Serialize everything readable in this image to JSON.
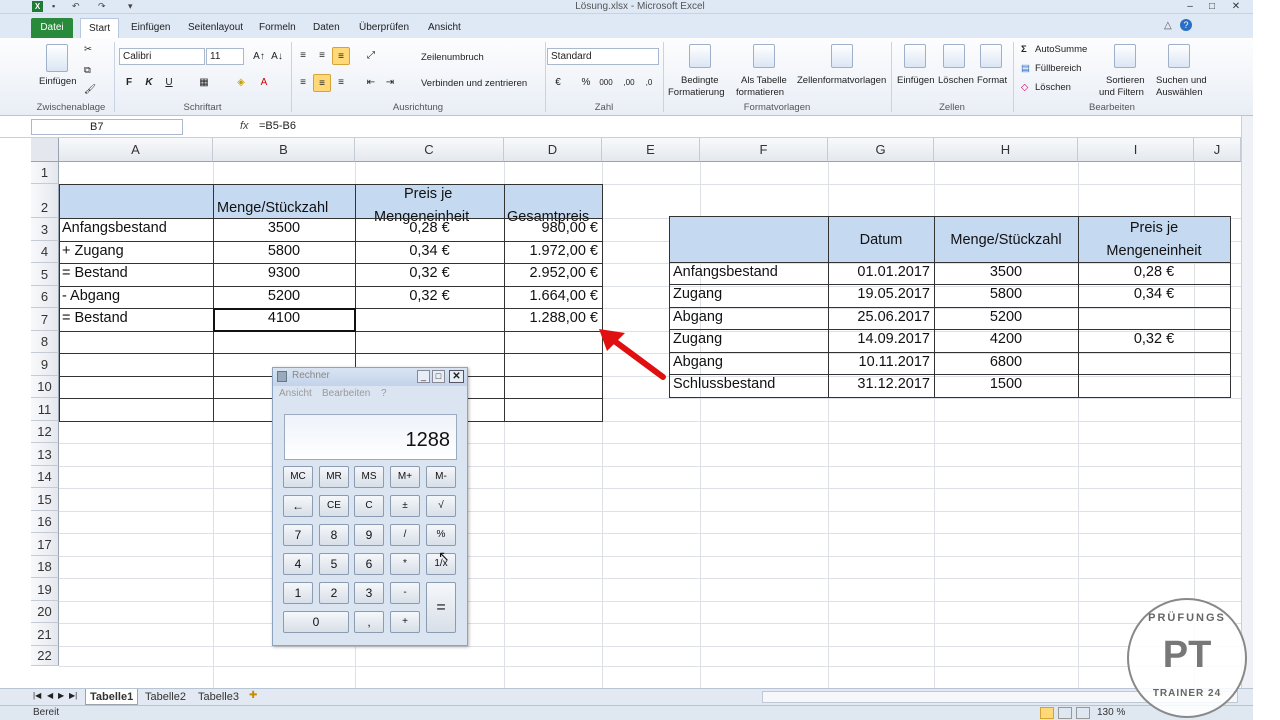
{
  "window": {
    "title": "Lösung.xlsx - Microsoft Excel",
    "controls": [
      "–",
      "□",
      "✕"
    ]
  },
  "tabs": [
    "Datei",
    "Start",
    "Einfügen",
    "Seitenlayout",
    "Formeln",
    "Daten",
    "Überprüfen",
    "Ansicht"
  ],
  "ribbon": {
    "clipboard": {
      "paste": "Einfügen",
      "group": "Zwischenablage"
    },
    "font": {
      "name": "Calibri",
      "size": "11",
      "bold": "F",
      "italic": "K",
      "underline": "U",
      "group": "Schriftart"
    },
    "alignment": {
      "wrap": "Zeilenumbruch",
      "merge": "Verbinden und zentrieren",
      "group": "Ausrichtung"
    },
    "number": {
      "format": "Standard",
      "group": "Zahl"
    },
    "styles": {
      "conditional": "Bedingte",
      "conditional2": "Formatierung",
      "astable": "Als Tabelle",
      "astable2": "formatieren",
      "cellstyles": "Zellenformatvorlagen",
      "group": "Formatvorlagen"
    },
    "cells": {
      "insert": "Einfügen",
      "delete": "Löschen",
      "format": "Format",
      "group": "Zellen"
    },
    "editing": {
      "autosum": "AutoSumme",
      "fill": "Füllbereich",
      "clear": "Löschen",
      "sort": "Sortieren",
      "sort2": "und Filtern",
      "find": "Suchen und",
      "find2": "Auswählen",
      "group": "Bearbeiten"
    }
  },
  "formula_bar": {
    "name_box": "B7",
    "fx": "fx",
    "formula": "=B5-B6"
  },
  "columns": [
    "A",
    "B",
    "C",
    "D",
    "E",
    "F",
    "G",
    "H",
    "I",
    "J"
  ],
  "rows": [
    "1",
    "2",
    "3",
    "4",
    "5",
    "6",
    "7",
    "8",
    "9",
    "10",
    "11",
    "12",
    "13",
    "14",
    "15",
    "16",
    "17",
    "18",
    "19",
    "20",
    "21",
    "22"
  ],
  "table1": {
    "header": {
      "b": "Menge/Stückzahl",
      "c1": "Preis je",
      "c2": "Mengeneinheit",
      "d": "Gesamtpreis"
    },
    "rows": [
      {
        "a": "Anfangsbestand",
        "b": "3500",
        "c": "0,28 €",
        "d": "980,00 €"
      },
      {
        "a": "+ Zugang",
        "b": "5800",
        "c": "0,34 €",
        "d": "1.972,00 €"
      },
      {
        "a": "= Bestand",
        "b": "9300",
        "c": "0,32 €",
        "d": "2.952,00 €"
      },
      {
        "a": "- Abgang",
        "b": "5200",
        "c": "0,32 €",
        "d": "1.664,00 €"
      },
      {
        "a": "= Bestand",
        "b": "4100",
        "c": "",
        "d": "1.288,00 €"
      }
    ]
  },
  "table2": {
    "header": {
      "g": "Datum",
      "h": "Menge/Stückzahl",
      "j1": "Preis je",
      "j2": "Mengeneinheit"
    },
    "rows": [
      {
        "f": "Anfangsbestand",
        "g": "01.01.2017",
        "h": "3500",
        "j": "0,28 €"
      },
      {
        "f": "Zugang",
        "g": "19.05.2017",
        "h": "5800",
        "j": "0,34 €"
      },
      {
        "f": "Abgang",
        "g": "25.06.2017",
        "h": "5200",
        "j": ""
      },
      {
        "f": "Zugang",
        "g": "14.09.2017",
        "h": "4200",
        "j": "0,32 €"
      },
      {
        "f": "Abgang",
        "g": "10.11.2017",
        "h": "6800",
        "j": ""
      },
      {
        "f": "Schlussbestand",
        "g": "31.12.2017",
        "h": "1500",
        "j": ""
      }
    ]
  },
  "calculator": {
    "title": "Rechner",
    "menu": [
      "Ansicht",
      "Bearbeiten",
      "?"
    ],
    "display": "1288",
    "keys": {
      "mc": "MC",
      "mr": "MR",
      "ms": "MS",
      "mplus": "M+",
      "mminus": "M-",
      "back": "←",
      "ce": "CE",
      "c": "C",
      "pm": "±",
      "sqrt": "√",
      "k7": "7",
      "k8": "8",
      "k9": "9",
      "div": "/",
      "pct": "%",
      "k4": "4",
      "k5": "5",
      "k6": "6",
      "mul": "*",
      "inv": "1/x",
      "k1": "1",
      "k2": "2",
      "k3": "3",
      "sub": "-",
      "eq": "=",
      "k0": "0",
      "dot": ",",
      "add": "+"
    }
  },
  "sheets": [
    "Tabelle1",
    "Tabelle2",
    "Tabelle3"
  ],
  "status": {
    "ready": "Bereit",
    "zoom": "130 %"
  },
  "logo": {
    "top": "PRÜFUNGS",
    "mid": "PT",
    "bottom": "TRAINER 24"
  },
  "colors": {
    "header_fill": "#c5d9f1",
    "arrow": "#e01010",
    "file_tab": "#2a8a3c"
  }
}
